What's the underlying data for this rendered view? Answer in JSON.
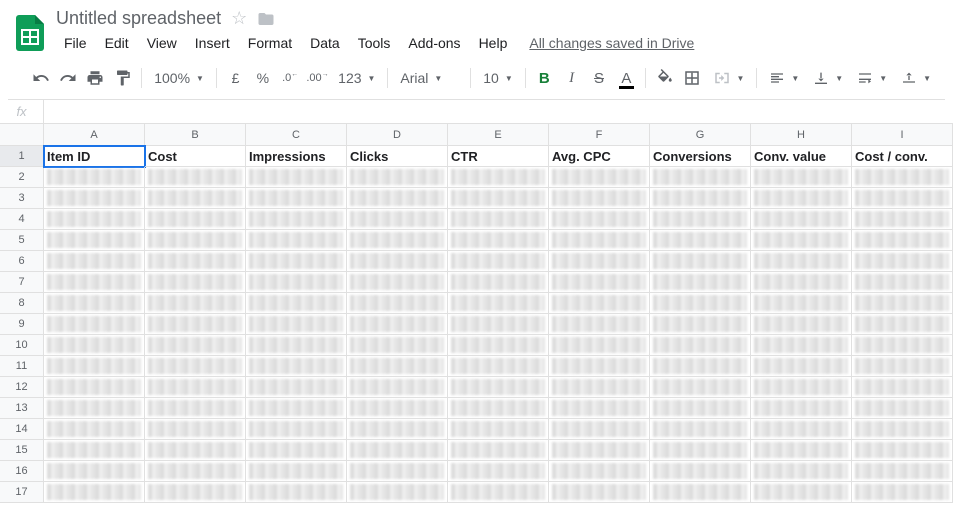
{
  "doc": {
    "title": "Untitled spreadsheet",
    "save_status": "All changes saved in Drive"
  },
  "menus": [
    "File",
    "Edit",
    "View",
    "Insert",
    "Format",
    "Data",
    "Tools",
    "Add-ons",
    "Help"
  ],
  "toolbar": {
    "zoom": "100%",
    "font": "Arial",
    "font_size": "10",
    "currency": "£",
    "percent": "%",
    "dec_dec": ".0",
    "inc_dec": ".00",
    "num_fmt": "123"
  },
  "fx_label": "fx",
  "columns": [
    "A",
    "B",
    "C",
    "D",
    "E",
    "F",
    "G",
    "H",
    "I"
  ],
  "col_widths": [
    "cw-A",
    "cw-B",
    "cw-C",
    "cw-D",
    "cw-E",
    "cw-F",
    "cw-G",
    "cw-H",
    "cw-I"
  ],
  "row_numbers": [
    1,
    2,
    3,
    4,
    5,
    6,
    7,
    8,
    9,
    10,
    11,
    12,
    13,
    14,
    15,
    16,
    17
  ],
  "headers": [
    "Item ID",
    "Cost",
    "Impressions",
    "Clicks",
    "CTR",
    "Avg. CPC",
    "Conversions",
    "Conv. value",
    "Cost / conv."
  ],
  "active_cell": {
    "row": 0,
    "col": 0
  }
}
